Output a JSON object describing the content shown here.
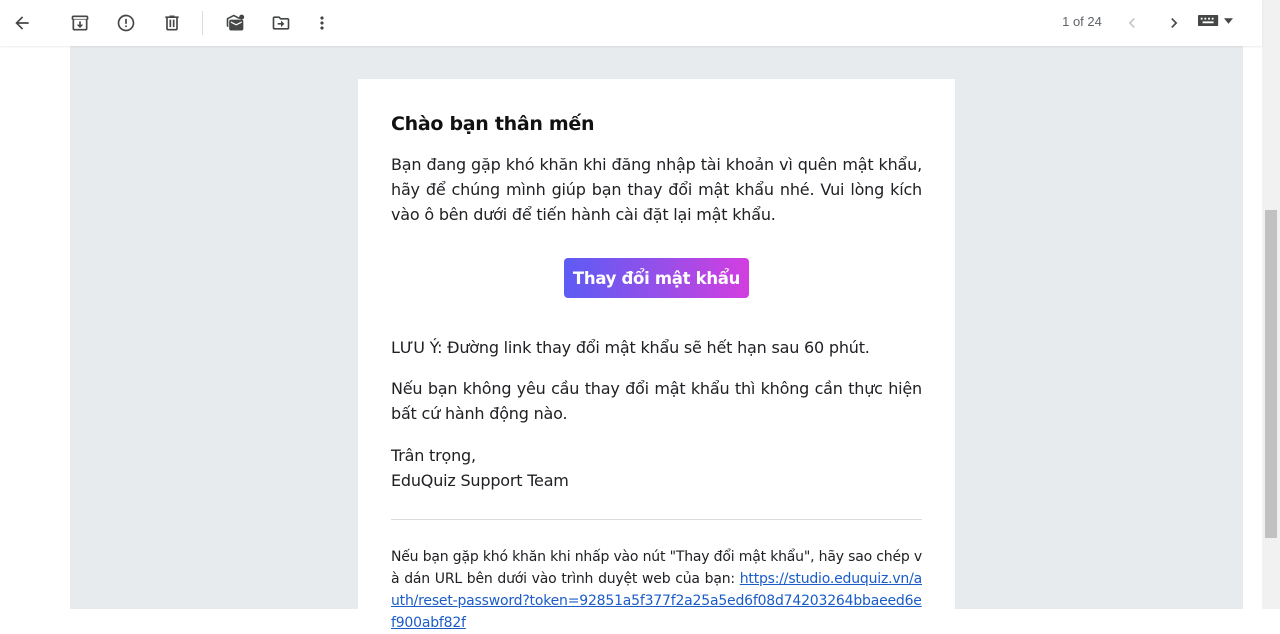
{
  "toolbar": {
    "icons": [
      "back-arrow-icon",
      "archive-icon",
      "report-spam-icon",
      "delete-icon",
      "mark-unread-icon",
      "move-to-icon",
      "more-vert-icon"
    ],
    "pager_text": "1 of 24"
  },
  "email": {
    "greeting": "Chào bạn thân mến",
    "paragraph1": "Bạn đang gặp khó khăn khi đăng nhập tài khoản vì quên mật khẩu, hãy để chúng mình giúp bạn thay đổi mật khẩu nhé. Vui lòng kích vào ô bên dưới để tiến hành cài đặt lại mật khẩu.",
    "button_label": "Thay đổi mật khẩu",
    "note": "LƯU Ý: Đường link thay đổi mật khẩu sẽ hết hạn sau 60 phút.",
    "paragraph2": "Nếu bạn không yêu cầu thay đổi mật khẩu thì không cần thực hiện bất cứ hành động nào.",
    "signoff": "Trân trọng,",
    "signature": "EduQuiz Support Team",
    "footer_text": "Nếu bạn gặp khó khăn khi nhấp vào nút \"Thay đổi mật khẩu\", hãy sao chép và dán URL bên dưới vào trình duyệt web của bạn: ",
    "reset_link": "https://studio.eduquiz.vn/auth/reset-password?token=92851a5f377f2a25a5ed6f08d74203264bbaeed6ef900abf82f"
  },
  "colors": {
    "canvas": "#e8ebee",
    "button_gradient_start": "#5c5cf4",
    "button_gradient_end": "#d33ee0",
    "link": "#1a5cc8"
  }
}
